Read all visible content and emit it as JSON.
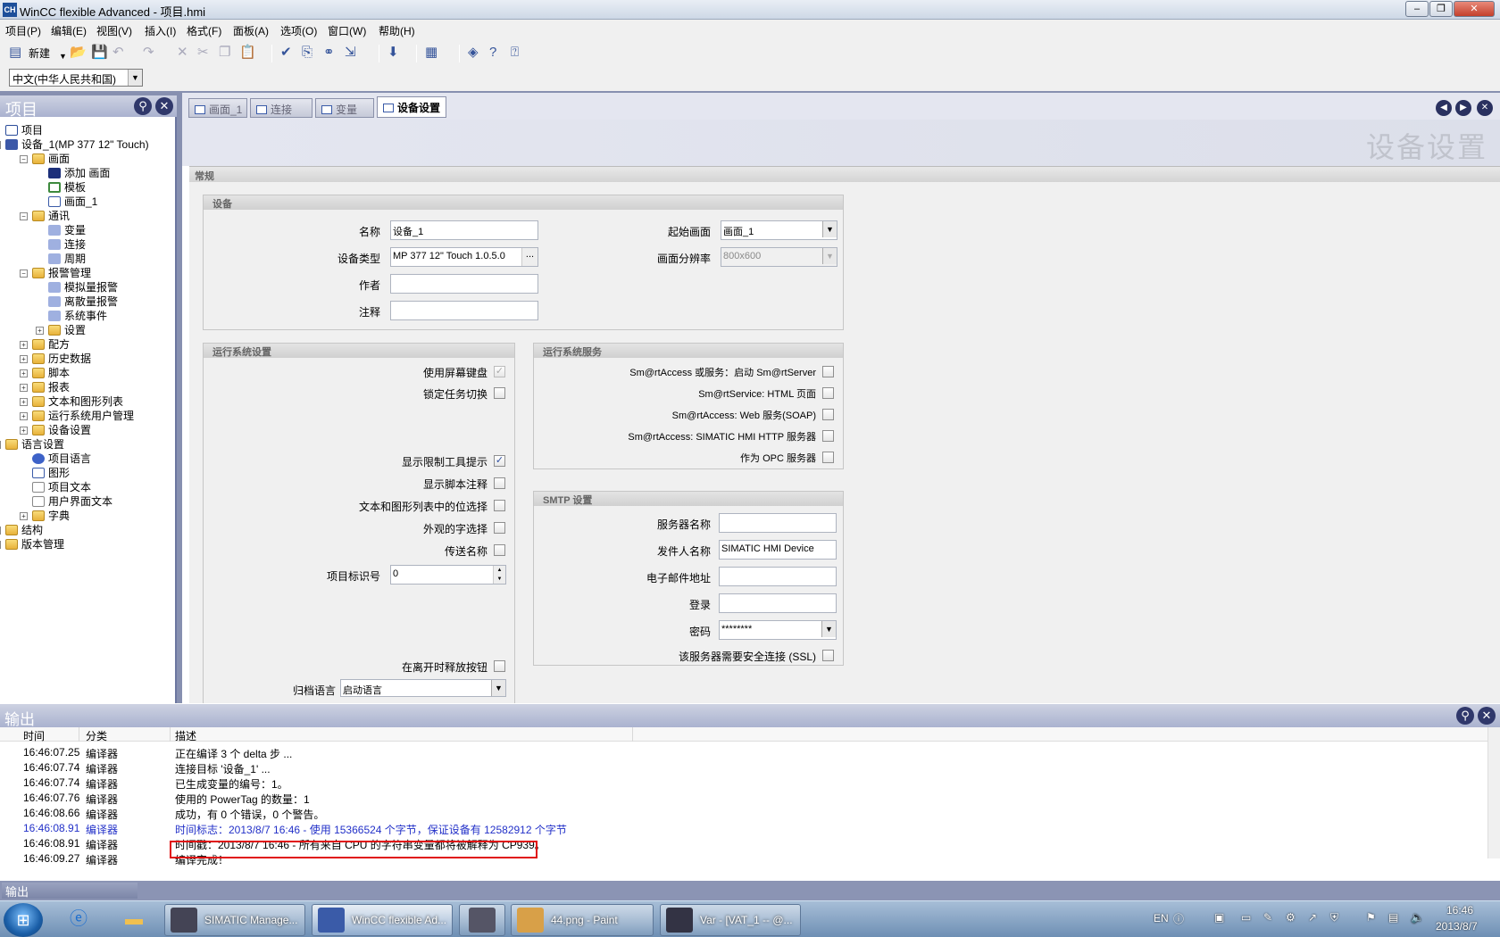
{
  "window": {
    "title": "WinCC flexible Advanced - 项目.hmi",
    "icon_text": "CH",
    "minimize": "–",
    "restore": "❐",
    "close": "✕"
  },
  "menu": [
    "项目(P)",
    "编辑(E)",
    "视图(V)",
    "插入(I)",
    "格式(F)",
    "面板(A)",
    "选项(O)",
    "窗口(W)",
    "帮助(H)"
  ],
  "toolbar": {
    "new_label": "新建",
    "language": "中文(中华人民共和国)"
  },
  "project_panel": {
    "title": "项目",
    "tree": [
      {
        "label": "项目",
        "icon": "project-icon",
        "level": 0
      },
      {
        "label": "设备_1(MP 377 12\" Touch)",
        "icon": "device-icon",
        "level": 0
      },
      {
        "label": "画面",
        "icon": "folder-icon",
        "level": 1
      },
      {
        "label": "添加 画面",
        "icon": "add-screen-icon",
        "level": 2
      },
      {
        "label": "模板",
        "icon": "template-icon",
        "level": 2
      },
      {
        "label": "画面_1",
        "icon": "screen-icon",
        "level": 2
      },
      {
        "label": "通讯",
        "icon": "folder-icon",
        "level": 1
      },
      {
        "label": "变量",
        "icon": "tags-icon",
        "level": 2
      },
      {
        "label": "连接",
        "icon": "connection-icon",
        "level": 2
      },
      {
        "label": "周期",
        "icon": "cycle-icon",
        "level": 2
      },
      {
        "label": "报警管理",
        "icon": "folder-icon",
        "level": 1
      },
      {
        "label": "模拟量报警",
        "icon": "analog-alarm-icon",
        "level": 2
      },
      {
        "label": "离散量报警",
        "icon": "discrete-alarm-icon",
        "level": 2
      },
      {
        "label": "系统事件",
        "icon": "system-event-icon",
        "level": 2
      },
      {
        "label": "设置",
        "icon": "folder-icon",
        "level": 2
      },
      {
        "label": "配方",
        "icon": "folder-icon",
        "level": 1
      },
      {
        "label": "历史数据",
        "icon": "folder-icon",
        "level": 1
      },
      {
        "label": "脚本",
        "icon": "folder-icon",
        "level": 1
      },
      {
        "label": "报表",
        "icon": "folder-icon",
        "level": 1
      },
      {
        "label": "文本和图形列表",
        "icon": "folder-icon",
        "level": 1
      },
      {
        "label": "运行系统用户管理",
        "icon": "folder-icon",
        "level": 1
      },
      {
        "label": "设备设置",
        "icon": "folder-icon",
        "level": 1
      },
      {
        "label": "语言设置",
        "icon": "folder-icon",
        "level": 0
      },
      {
        "label": "项目语言",
        "icon": "globe-icon",
        "level": 1
      },
      {
        "label": "图形",
        "icon": "graphics-icon",
        "level": 1
      },
      {
        "label": "项目文本",
        "icon": "document-icon",
        "level": 1
      },
      {
        "label": "用户界面文本",
        "icon": "document-icon",
        "level": 1
      },
      {
        "label": "字典",
        "icon": "folder-icon",
        "level": 1
      },
      {
        "label": "结构",
        "icon": "folder-icon",
        "level": 0
      },
      {
        "label": "版本管理",
        "icon": "folder-icon",
        "level": 0
      }
    ]
  },
  "tabs": [
    {
      "label": "画面_1",
      "active": false
    },
    {
      "label": "连接",
      "active": false
    },
    {
      "label": "变量",
      "active": false
    },
    {
      "label": "设备设置",
      "active": true
    }
  ],
  "device_settings": {
    "page_title": "设备设置",
    "general_section": "常规",
    "device_group": {
      "title": "设备",
      "name_label": "名称",
      "name_value": "设备_1",
      "type_label": "设备类型",
      "type_value": "MP 377 12\" Touch 1.0.5.0",
      "author_label": "作者",
      "author_value": "",
      "comment_label": "注释",
      "comment_value": "",
      "start_screen_label": "起始画面",
      "start_screen_value": "画面_1",
      "resolution_label": "画面分辨率",
      "resolution_value": "800x600"
    },
    "runtime_settings": {
      "title": "运行系统设置",
      "options": [
        {
          "label": "使用屏幕键盘",
          "checked": true,
          "disabled": true
        },
        {
          "label": "锁定任务切换",
          "checked": false
        },
        {
          "label": "显示限制工具提示",
          "checked": true
        },
        {
          "label": "显示脚本注释",
          "checked": false
        },
        {
          "label": "文本和图形列表中的位选择",
          "checked": false
        },
        {
          "label": "外观的字选择",
          "checked": false
        },
        {
          "label": "传送名称",
          "checked": false
        }
      ],
      "project_id_label": "项目标识号",
      "project_id_value": "0",
      "release_on_leave_label": "在离开时释放按钮",
      "archive_lang_label": "归档语言",
      "archive_lang_value": "启动语言"
    },
    "runtime_services": {
      "title": "运行系统服务",
      "options": [
        {
          "label": "Sm@rtAccess 或服务：启动 Sm@rtServer",
          "checked": false
        },
        {
          "label": "Sm@rtService: HTML 页面",
          "checked": false
        },
        {
          "label": "Sm@rtAccess: Web 服务(SOAP)",
          "checked": false
        },
        {
          "label": "Sm@rtAccess: SIMATIC HMI HTTP 服务器",
          "checked": false
        },
        {
          "label": "作为 OPC 服务器",
          "checked": false
        }
      ]
    },
    "smtp": {
      "title": "SMTP 设置",
      "server_label": "服务器名称",
      "server_value": "",
      "sender_label": "发件人名称",
      "sender_value": "SIMATIC HMI Device",
      "email_label": "电子邮件地址",
      "email_value": "",
      "login_label": "登录",
      "login_value": "",
      "password_label": "密码",
      "password_value": "********",
      "ssl_label": "该服务器需要安全连接 (SSL)"
    }
  },
  "output": {
    "title": "输出",
    "columns": [
      "时间",
      "分类",
      "描述"
    ],
    "rows": [
      {
        "time": "16:46:07.25",
        "category": "编译器",
        "desc": "正在编译 3 个 delta 步 ...",
        "blue": false
      },
      {
        "time": "16:46:07.74",
        "category": "编译器",
        "desc": "连接目标 '设备_1' ...",
        "blue": false
      },
      {
        "time": "16:46:07.74",
        "category": "编译器",
        "desc": "已生成变量的编号：1。",
        "blue": false
      },
      {
        "time": "16:46:07.76",
        "category": "编译器",
        "desc": "使用的 PowerTag 的数量：1",
        "blue": false
      },
      {
        "time": "16:46:08.66",
        "category": "编译器",
        "desc": "成功，有 0 个错误，0 个警告。",
        "blue": false
      },
      {
        "time": "16:46:08.91",
        "category": "编译器",
        "desc": "时间标志：2013/8/7 16:46 - 使用 15366524 个字节，保证设备有 12582912 个字节",
        "blue": true
      },
      {
        "time": "16:46:08.91",
        "category": "编译器",
        "desc": "时间戳：2013/8/7 16:46 - 所有来自 CPU 的字符串变量都将被解释为 CP939。",
        "blue": false
      },
      {
        "time": "16:46:09.27",
        "category": "编译器",
        "desc": "编译完成！",
        "blue": false
      }
    ],
    "bottom_tab": "输出"
  },
  "taskbar": {
    "tasks": [
      {
        "label": "SIMATIC Manage...",
        "active": false
      },
      {
        "label": "WinCC flexible Ad...",
        "active": true
      },
      {
        "label": "",
        "active": false
      },
      {
        "label": "44.png - Paint",
        "active": false
      },
      {
        "label": "Var - [VAT_1 -- @...",
        "active": false
      }
    ],
    "lang": "EN",
    "time": "16:46",
    "date": "2013/8/7"
  },
  "colors": {
    "highlight": "#e01010",
    "blue_text": "#2230c8",
    "panel_header": "#aab2cf"
  }
}
